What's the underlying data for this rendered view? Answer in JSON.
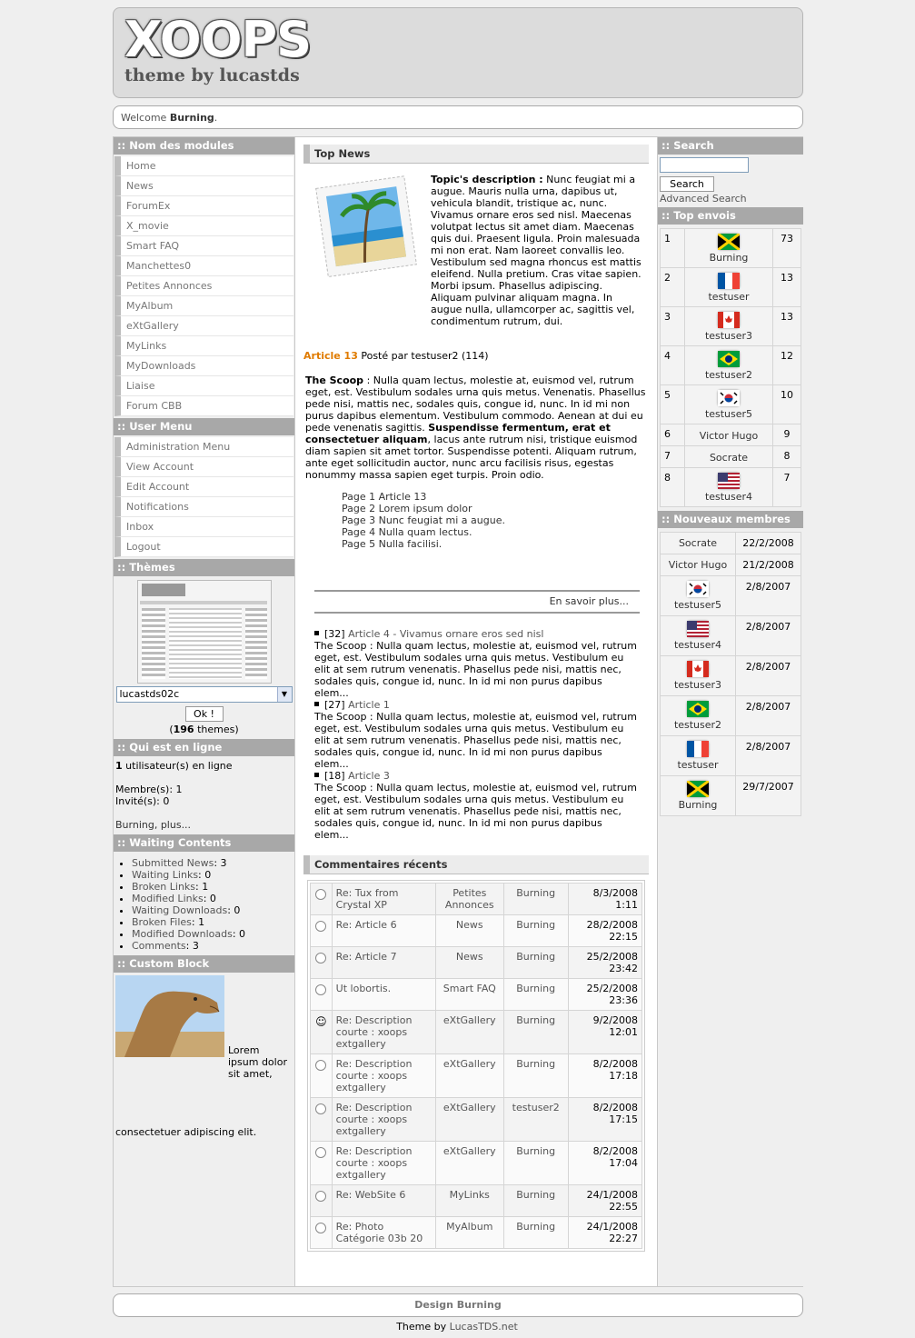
{
  "header": {
    "logo_big": "XOOPS",
    "logo_small": "theme by lucastds"
  },
  "welcome": {
    "prefix": "Welcome",
    "user": "Burning",
    "suffix": "."
  },
  "left": {
    "modules_title": ":: Nom des modules",
    "modules": [
      "Home",
      "News",
      "ForumEx",
      "X_movie",
      "Smart FAQ",
      "Manchettes0",
      "Petites Annonces",
      "MyAlbum",
      "eXtGallery",
      "MyLinks",
      "MyDownloads",
      "Liaise",
      "Forum CBB"
    ],
    "user_title": ":: User Menu",
    "user_menu": [
      "Administration Menu",
      "View Account",
      "Edit Account",
      "Notifications",
      "Inbox",
      "Logout"
    ],
    "themes_title": ":: Thèmes",
    "theme_selected": "lucastds02c",
    "theme_ok": "Ok !",
    "theme_count": "196",
    "theme_count_suffix": "themes",
    "online_title": ":: Qui est en ligne",
    "online_count": "1",
    "online_text": "utilisateur(s) en ligne",
    "members": "Membre(s): 1",
    "guests": "Invité(s): 0",
    "online_more": "Burning, plus...",
    "waiting_title": ":: Waiting Contents",
    "waiting": [
      {
        "label": "Submitted News",
        "value": "3"
      },
      {
        "label": "Waiting Links",
        "value": "0"
      },
      {
        "label": "Broken Links",
        "value": "1"
      },
      {
        "label": "Modified Links",
        "value": "0"
      },
      {
        "label": "Waiting Downloads",
        "value": "0"
      },
      {
        "label": "Broken Files",
        "value": "1"
      },
      {
        "label": "Modified Downloads",
        "value": "0"
      },
      {
        "label": "Comments",
        "value": "3"
      }
    ],
    "custom_title": ":: Custom Block",
    "custom_text": "Lorem ipsum dolor sit amet, consectetuer adipiscing elit."
  },
  "center": {
    "topnews_title": "Top News",
    "topic_label": "Topic's description :",
    "topic_text": "Nunc feugiat mi a augue. Mauris nulla urna, dapibus ut, vehicula blandit, tristique ac, nunc. Vivamus ornare eros sed nisl. Maecenas volutpat lectus sit amet diam. Maecenas quis dui. Praesent ligula. Proin malesuada mi non erat. Nam laoreet convallis leo. Vestibulum sed magna rhoncus est mattis eleifend. Nulla pretium. Cras vitae sapien. Morbi ipsum. Phasellus adipiscing. Aliquam pulvinar aliquam magna. In augue nulla, ullamcorper ac, sagittis vel, condimentum rutrum, dui.",
    "article_title": "Article 13",
    "article_meta": "Posté par testuser2 (114)",
    "scoop_label": "The Scoop",
    "scoop_text1": ": Nulla quam lectus, molestie at, euismod vel, rutrum eget, est. Vestibulum sodales urna quis metus. Venenatis. Phasellus pede nisi, mattis nec, sodales quis, congue id, nunc. In id mi non purus dapibus elementum. Vestibulum commodo. Aenean at dui eu pede venenatis sagittis.",
    "scoop_bold": "Suspendisse fermentum, erat et consectetuer aliquam",
    "scoop_text2": ", lacus ante rutrum nisi, tristique euismod diam sapien sit amet tortor. Suspendisse potenti. Aliquam rutrum, ante eget sollicitudin auctor, nunc arcu facilisis risus, egestas nonummy massa sapien eget turpis. Proin odio.",
    "pages": [
      "Page 1 Article 13",
      "Page 2 Lorem ipsum dolor",
      "Page 3 Nunc feugiat mi a augue.",
      "Page 4 Nulla quam lectus.",
      "Page 5 Nulla facilisi."
    ],
    "more": "En savoir plus...",
    "news": [
      {
        "id": "[32]",
        "title": "Article 4 - Vivamus ornare eros sed nisl",
        "text": "The Scoop : Nulla quam lectus, molestie at, euismod vel, rutrum eget, est. Vestibulum sodales urna quis metus. Vestibulum eu elit at sem rutrum venenatis. Phasellus pede nisi, mattis nec, sodales quis, congue id, nunc. In id mi non purus dapibus elem..."
      },
      {
        "id": "[27]",
        "title": "Article 1",
        "text": "The Scoop : Nulla quam lectus, molestie at, euismod vel, rutrum eget, est. Vestibulum sodales urna quis metus. Vestibulum eu elit at sem rutrum venenatis. Phasellus pede nisi, mattis nec, sodales quis, congue id, nunc. In id mi non purus dapibus elem..."
      },
      {
        "id": "[18]",
        "title": "Article 3",
        "text": "The Scoop : Nulla quam lectus, molestie at, euismod vel, rutrum eget, est. Vestibulum sodales urna quis metus. Vestibulum eu elit at sem rutrum venenatis. Phasellus pede nisi, mattis nec, sodales quis, congue id, nunc. In id mi non purus dapibus elem..."
      }
    ],
    "comments_title": "Commentaires récents",
    "comments": [
      {
        "icon": "radio",
        "title": "Re: Tux from Crystal XP",
        "module": "Petites Annonces",
        "user": "Burning",
        "date": "8/3/2008 1:11"
      },
      {
        "icon": "radio",
        "title": "Re: Article 6",
        "module": "News",
        "user": "Burning",
        "date": "28/2/2008 22:15"
      },
      {
        "icon": "radio",
        "title": "Re: Article 7",
        "module": "News",
        "user": "Burning",
        "date": "25/2/2008 23:42"
      },
      {
        "icon": "radio",
        "title": "Ut lobortis.",
        "module": "Smart FAQ",
        "user": "Burning",
        "date": "25/2/2008 23:36"
      },
      {
        "icon": "smiley",
        "title": "Re: Description courte : xoops extgallery",
        "module": "eXtGallery",
        "user": "Burning",
        "date": "9/2/2008 12:01"
      },
      {
        "icon": "radio",
        "title": "Re: Description courte : xoops extgallery",
        "module": "eXtGallery",
        "user": "Burning",
        "date": "8/2/2008 17:18"
      },
      {
        "icon": "radio",
        "title": "Re: Description courte : xoops extgallery",
        "module": "eXtGallery",
        "user": "testuser2",
        "date": "8/2/2008 17:15"
      },
      {
        "icon": "radio",
        "title": "Re: Description courte : xoops extgallery",
        "module": "eXtGallery",
        "user": "Burning",
        "date": "8/2/2008 17:04"
      },
      {
        "icon": "radio",
        "title": "Re: WebSite 6",
        "module": "MyLinks",
        "user": "Burning",
        "date": "24/1/2008 22:55"
      },
      {
        "icon": "radio",
        "title": "Re: Photo Catégorie 03b 20",
        "module": "MyAlbum",
        "user": "Burning",
        "date": "24/1/2008 22:27"
      }
    ]
  },
  "right": {
    "search_title": ":: Search",
    "search_value": "",
    "search_button": "Search",
    "advanced": "Advanced Search",
    "top_title": ":: Top envois",
    "top": [
      {
        "rank": "1",
        "name": "Burning",
        "flag": "jamaica",
        "count": "73"
      },
      {
        "rank": "2",
        "name": "testuser",
        "flag": "france",
        "count": "13"
      },
      {
        "rank": "3",
        "name": "testuser3",
        "flag": "canada",
        "count": "13"
      },
      {
        "rank": "4",
        "name": "testuser2",
        "flag": "brazil",
        "count": "12"
      },
      {
        "rank": "5",
        "name": "testuser5",
        "flag": "korea",
        "count": "10"
      },
      {
        "rank": "6",
        "name": "Victor Hugo",
        "flag": "",
        "count": "9"
      },
      {
        "rank": "7",
        "name": "Socrate",
        "flag": "",
        "count": "8"
      },
      {
        "rank": "8",
        "name": "testuser4",
        "flag": "usa",
        "count": "7"
      }
    ],
    "new_title": ":: Nouveaux membres",
    "new_members": [
      {
        "name": "Socrate",
        "flag": "",
        "date": "22/2/2008"
      },
      {
        "name": "Victor Hugo",
        "flag": "",
        "date": "21/2/2008"
      },
      {
        "name": "testuser5",
        "flag": "korea",
        "date": "2/8/2007"
      },
      {
        "name": "testuser4",
        "flag": "usa",
        "date": "2/8/2007"
      },
      {
        "name": "testuser3",
        "flag": "canada",
        "date": "2/8/2007"
      },
      {
        "name": "testuser2",
        "flag": "brazil",
        "date": "2/8/2007"
      },
      {
        "name": "testuser",
        "flag": "france",
        "date": "2/8/2007"
      },
      {
        "name": "Burning",
        "flag": "jamaica",
        "date": "29/7/2007"
      }
    ]
  },
  "footer": {
    "design": "Design Burning",
    "theme_prefix": "Theme by",
    "theme_link": "LucasTDS.net"
  },
  "colors": {
    "accent": "#e07b00",
    "title_bar": "#a8a8a8",
    "link": "#555555"
  }
}
